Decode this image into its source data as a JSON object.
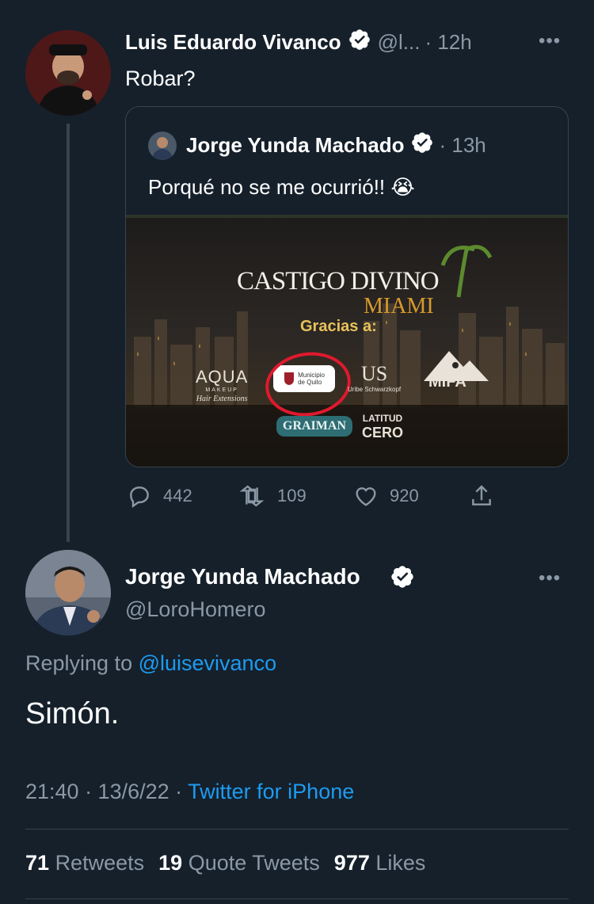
{
  "tweet1": {
    "name": "Luis Eduardo Vivanco",
    "handle": "@l...",
    "time": "· 12h",
    "text": "Robar?",
    "quote": {
      "name": "Jorge Yunda Machado",
      "time": "· 13h",
      "text": "Porqué no se me ocurrió!! 😭",
      "image": {
        "title": "CASTIGO DIVINO",
        "subtitle": "MIAMI",
        "thanks": "Gracias a:",
        "logo_aqua": "AQUA",
        "logo_aqua_sub": "MAKEUP",
        "logo_aqua_script": "Hair Extensions",
        "logo_municipio_1": "Municipio",
        "logo_municipio_2": "de Quito",
        "logo_uribe_mark": "US",
        "logo_uribe": "Uribe Schwarzkopf",
        "logo_mifa": "MIFA",
        "logo_graiman": "GRAIMAN",
        "logo_latitud_1": "LATITUD",
        "logo_latitud_2": "CERO"
      }
    },
    "actions": {
      "replies": "442",
      "retweets": "109",
      "likes": "920"
    }
  },
  "tweet2": {
    "name": "Jorge Yunda Machado",
    "handle": "@LoroHomero",
    "replying_prefix": "Replying to",
    "replying_to": "@luisevivanco",
    "text": "Simón.",
    "time": "21:40 · 13/6/22 ·",
    "source": "Twitter for iPhone",
    "stats": {
      "retweets_count": "71",
      "retweets_label": "Retweets",
      "quotes_count": "19",
      "quotes_label": "Quote Tweets",
      "likes_count": "977",
      "likes_label": "Likes"
    }
  },
  "colors": {
    "background": "#15202b",
    "muted": "#8b98a5",
    "link": "#1d9bf0",
    "verified": "#ffffff",
    "annotation_circle": "#e0192e"
  }
}
